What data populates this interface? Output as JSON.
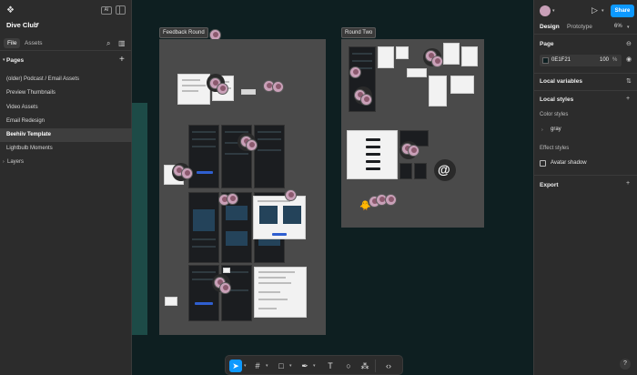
{
  "left_panel": {
    "ai_badge": "AI",
    "file_name": "Dive Club",
    "tabs": {
      "file": "File",
      "assets": "Assets"
    },
    "pages_header": "Pages",
    "pages": [
      {
        "label": "(older) Podcast / Email Assets"
      },
      {
        "label": "Preview Thumbnails"
      },
      {
        "label": "Video Assets"
      },
      {
        "label": "Email Redesign"
      },
      {
        "label": "Beehiiv Template"
      },
      {
        "label": "Lightbulb Moments"
      }
    ],
    "layers_header": "Layers"
  },
  "canvas": {
    "sections": [
      {
        "label": "Feedback Round"
      },
      {
        "label": "Round Two"
      }
    ]
  },
  "right_panel": {
    "share": "Share",
    "tabs": {
      "design": "Design",
      "prototype": "Prototype"
    },
    "zoom": "6%",
    "page": {
      "title": "Page",
      "color_hex": "0E1F21",
      "opacity": "100",
      "opacity_unit": "%"
    },
    "local_variables": "Local variables",
    "local_styles": "Local styles",
    "color_styles": {
      "title": "Color styles",
      "items": [
        "gray"
      ]
    },
    "effect_styles": {
      "title": "Effect styles",
      "items": [
        "Avatar shadow"
      ]
    },
    "export": "Export"
  },
  "help": "?",
  "colors": {
    "canvas_bg": "#0E1F21",
    "accent": "#0D99FF",
    "panel": "#2C2C2C"
  },
  "icons": [
    "figma-menu-icon",
    "panel-toggle-icon",
    "search-icon",
    "book-icon",
    "plus-icon",
    "play-icon",
    "eye-icon",
    "variables-icon",
    "move-tool-icon",
    "frame-tool-icon",
    "shape-tool-icon",
    "pen-tool-icon",
    "text-tool-icon",
    "comment-tool-icon",
    "actions-icon",
    "dev-mode-icon"
  ]
}
